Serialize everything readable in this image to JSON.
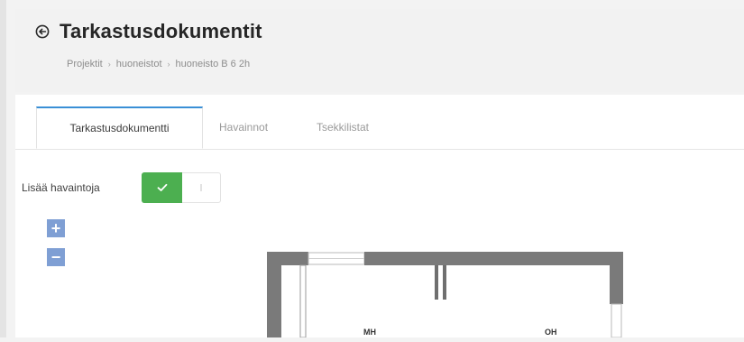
{
  "header": {
    "title": "Tarkastusdokumentit",
    "breadcrumb": [
      "Projektit",
      "huoneistot",
      "huoneisto B 6 2h"
    ]
  },
  "tabs": [
    {
      "label": "Tarkastusdokumentti",
      "active": true
    },
    {
      "label": "Havainnot",
      "active": false
    },
    {
      "label": "Tsekkilistat",
      "active": false
    }
  ],
  "observation_toggle": {
    "label": "Lisää havaintoja",
    "state": "on",
    "on_color": "#4caf50"
  },
  "zoom": {
    "in_label": "+",
    "out_label": "−"
  },
  "floorplan": {
    "rooms": [
      "MH",
      "OH"
    ]
  },
  "colors": {
    "accent": "#3a8fd6",
    "zoom_button": "#7f9fd4",
    "wall": "#7a7a7a"
  }
}
